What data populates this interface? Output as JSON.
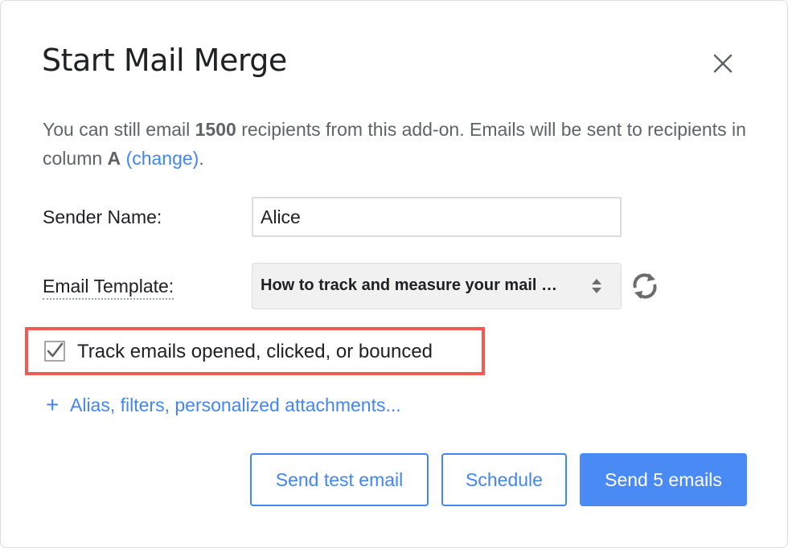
{
  "dialog": {
    "title": "Start Mail Merge"
  },
  "intro": {
    "part1": "You can still email ",
    "count": "1500",
    "part2": " recipients from this add-on. Emails will be sent to recipients in column ",
    "column": "A",
    "change_link": "(change)",
    "end": "."
  },
  "form": {
    "sender_label": "Sender Name:",
    "sender_value": "Alice",
    "template_label": "Email Template:",
    "template_value": "How to track and measure your mail …"
  },
  "tracking": {
    "label": "Track emails opened, clicked, or bounced",
    "checked": true
  },
  "advanced": {
    "plus": "+",
    "label": "Alias, filters, personalized attachments..."
  },
  "buttons": {
    "test": "Send test email",
    "schedule": "Schedule",
    "send": "Send 5 emails"
  },
  "colors": {
    "accent": "#4285f4",
    "highlight": "#f05a50",
    "muted_text": "#5f6368"
  },
  "icons": {
    "close": "close-icon",
    "refresh": "refresh-icon",
    "select_arrows": "select-arrows-icon",
    "checkbox": "checkbox-checked-icon"
  }
}
